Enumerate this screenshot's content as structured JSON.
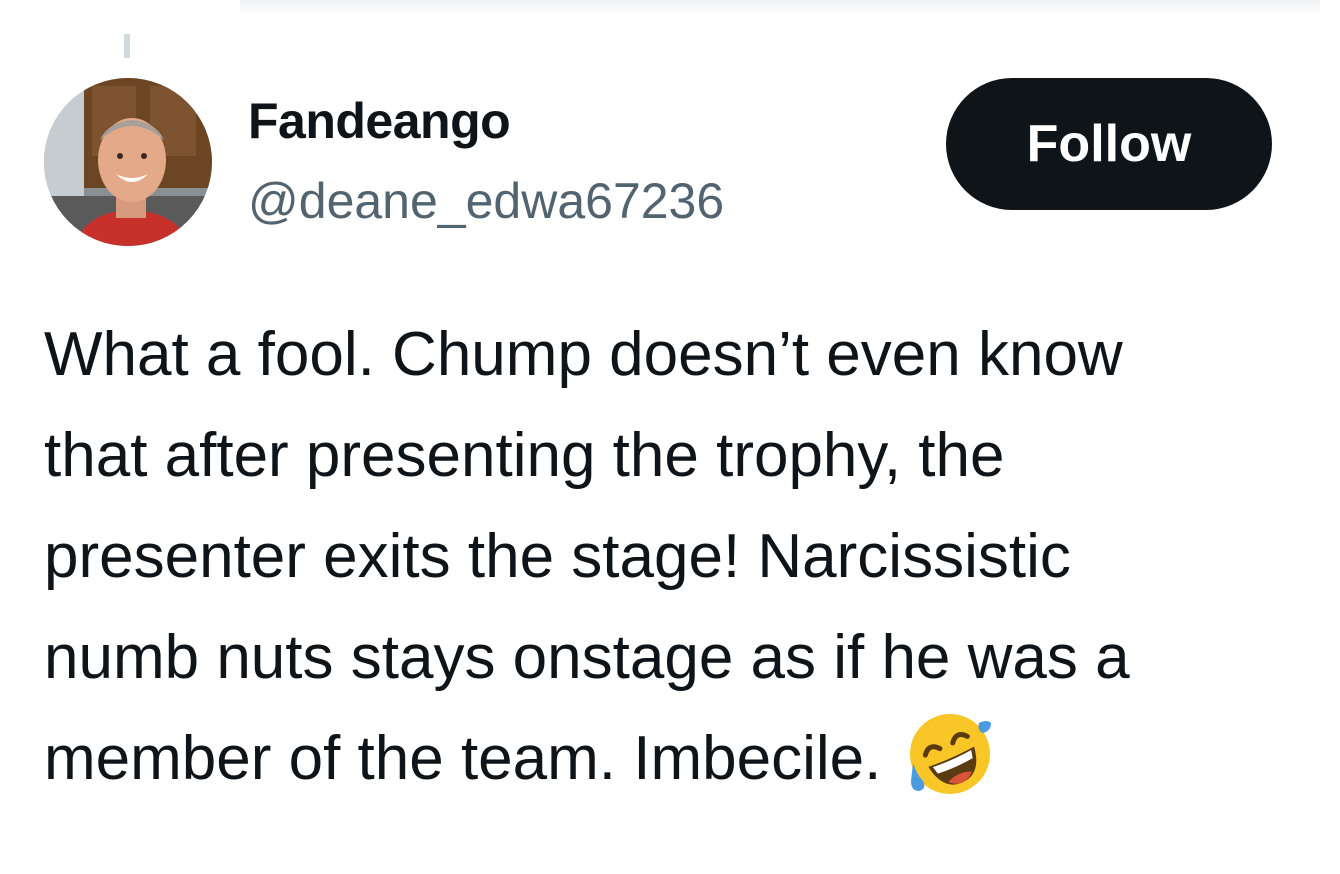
{
  "tweet": {
    "author": {
      "display_name": "Fandeango",
      "handle": "@deane_edwa67236",
      "avatar_icon": "profile-photo"
    },
    "follow_label": "Follow",
    "text": "What a fool. Chump doesn’t even know\nthat after presenting the trophy, the\npresenter exits the stage! Narcissistic\nnumb nuts stays onstage as if he was a\nmember of the team. Imbecile.",
    "emoji_icon": "rolling-on-the-floor-laughing-emoji"
  },
  "colors": {
    "text_primary": "#0f1419",
    "text_secondary": "#536471",
    "button_bg": "#0f1419",
    "button_text": "#ffffff",
    "thread_line": "#cfd9de"
  }
}
